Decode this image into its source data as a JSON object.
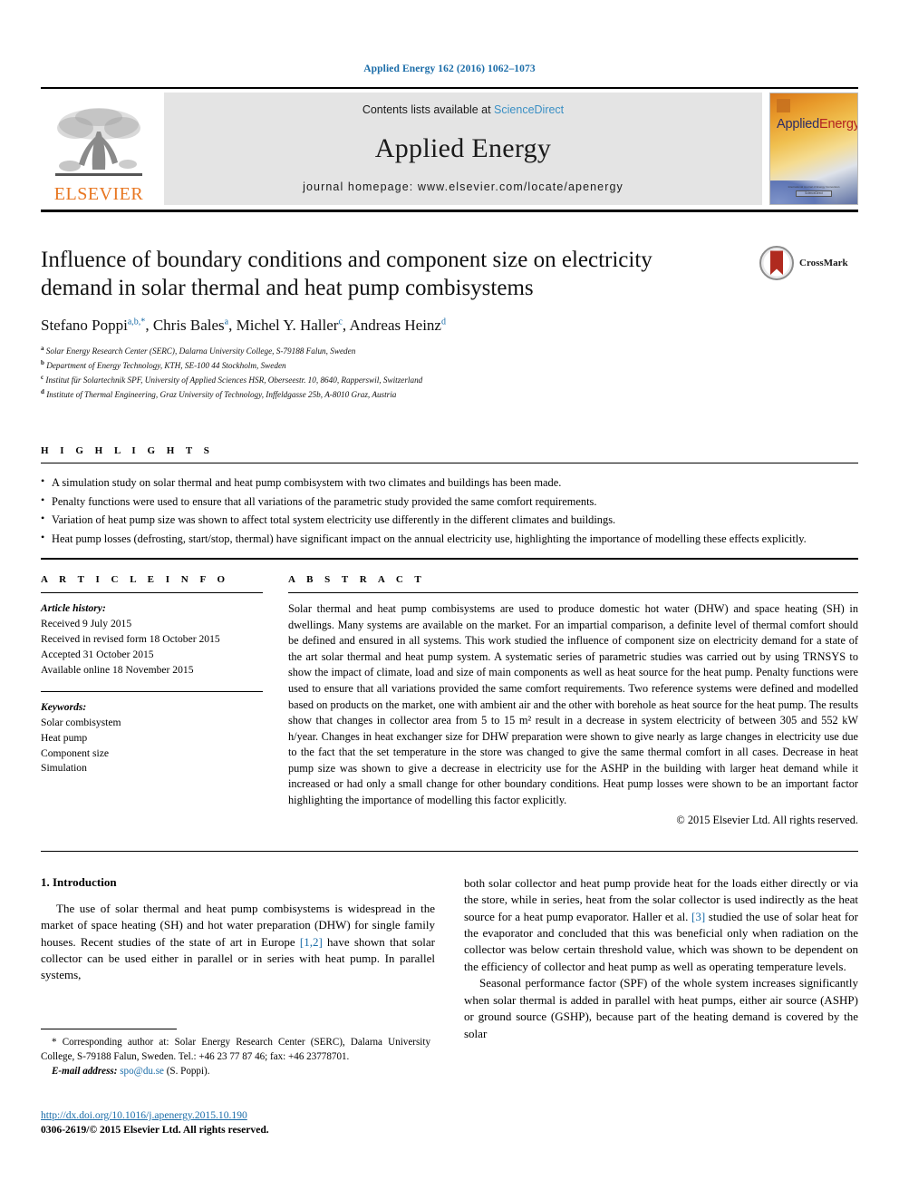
{
  "running_head": "Applied Energy 162 (2016) 1062–1073",
  "masthead": {
    "contents_prefix": "Contents lists available at ",
    "sciencedirect": "ScienceDirect",
    "journal_name": "Applied Energy",
    "homepage": "journal homepage: www.elsevier.com/locate/apenergy",
    "publisher_word": "ELSEVIER",
    "cover_title_a": "Applied",
    "cover_title_b": "Energy",
    "cover_footer": "International Journal of Energy Conversion",
    "cover_footer_box": "ScienceDirect",
    "colors": {
      "link_blue": "#1a6ca8",
      "sciencedirect_blue": "#3a8fc4",
      "elsevier_orange": "#E87722",
      "masthead_gray": "#e4e4e4"
    }
  },
  "crossmark": {
    "label": "CrossMark"
  },
  "title": "Influence of boundary conditions and component size on electricity demand in solar thermal and heat pump combisystems",
  "authors": [
    {
      "name": "Stefano Poppi",
      "sup": "a,b,*"
    },
    {
      "name": "Chris Bales",
      "sup": "a"
    },
    {
      "name": "Michel Y. Haller",
      "sup": "c"
    },
    {
      "name": "Andreas Heinz",
      "sup": "d"
    }
  ],
  "affiliations": [
    {
      "mark": "a",
      "text": "Solar Energy Research Center (SERC), Dalarna University College, S-79188 Falun, Sweden"
    },
    {
      "mark": "b",
      "text": "Department of Energy Technology, KTH, SE-100 44 Stockholm, Sweden"
    },
    {
      "mark": "c",
      "text": "Institut für Solartechnik SPF, University of Applied Sciences HSR, Oberseestr. 10, 8640, Rapperswil, Switzerland"
    },
    {
      "mark": "d",
      "text": "Institute of Thermal Engineering, Graz University of Technology, Inffeldgasse 25b, A-8010 Graz, Austria"
    }
  ],
  "highlights": {
    "heading": "H I G H L I G H T S",
    "items": [
      "A simulation study on solar thermal and heat pump combisystem with two climates and buildings has been made.",
      "Penalty functions were used to ensure that all variations of the parametric study provided the same comfort requirements.",
      "Variation of heat pump size was shown to affect total system electricity use differently in the different climates and buildings.",
      "Heat pump losses (defrosting, start/stop, thermal) have significant impact on the annual electricity use, highlighting the importance of modelling these effects explicitly."
    ]
  },
  "article_info": {
    "heading": "A R T I C L E    I N F O",
    "history_label": "Article history:",
    "history": [
      "Received 9 July 2015",
      "Received in revised form 18 October 2015",
      "Accepted 31 October 2015",
      "Available online 18 November 2015"
    ],
    "keywords_label": "Keywords:",
    "keywords": [
      "Solar combisystem",
      "Heat pump",
      "Component size",
      "Simulation"
    ]
  },
  "abstract": {
    "heading": "A B S T R A C T",
    "text": "Solar thermal and heat pump combisystems are used to produce domestic hot water (DHW) and space heating (SH) in dwellings. Many systems are available on the market. For an impartial comparison, a definite level of thermal comfort should be defined and ensured in all systems. This work studied the influence of component size on electricity demand for a state of the art solar thermal and heat pump system. A systematic series of parametric studies was carried out by using TRNSYS to show the impact of climate, load and size of main components as well as heat source for the heat pump. Penalty functions were used to ensure that all variations provided the same comfort requirements. Two reference systems were defined and modelled based on products on the market, one with ambient air and the other with borehole as heat source for the heat pump. The results show that changes in collector area from 5 to 15 m² result in a decrease in system electricity of between 305 and 552 kW h/year. Changes in heat exchanger size for DHW preparation were shown to give nearly as large changes in electricity use due to the fact that the set temperature in the store was changed to give the same thermal comfort in all cases. Decrease in heat pump size was shown to give a decrease in electricity use for the ASHP in the building with larger heat demand while it increased or had only a small change for other boundary conditions. Heat pump losses were shown to be an important factor highlighting the importance of modelling this factor explicitly.",
    "copyright": "© 2015 Elsevier Ltd. All rights reserved."
  },
  "introduction": {
    "section_number_title": "1. Introduction",
    "left_para_1_a": "The use of solar thermal and heat pump combisystems is widespread in the market of space heating (SH) and hot water preparation (DHW) for single family houses. Recent studies of the state of art in Europe ",
    "left_ref_1": "[1,2]",
    "left_para_1_b": " have shown that solar collector can be used either in parallel or in series with heat pump. In parallel systems,",
    "right_para_1_a": "both solar collector and heat pump provide heat for the loads either directly or via the store, while in series, heat from the solar collector is used indirectly as the heat source for a heat pump evaporator. Haller et al. ",
    "right_ref_1": "[3]",
    "right_para_1_b": " studied the use of solar heat for the evaporator and concluded that this was beneficial only when radiation on the collector was below certain threshold value, which was shown to be dependent on the efficiency of collector and heat pump as well as operating temperature levels.",
    "right_para_2": "Seasonal performance factor (SPF) of the whole system increases significantly when solar thermal is added in parallel with heat pumps, either air source (ASHP) or ground source (GSHP), because part of the heating demand is covered by the solar"
  },
  "footnote": {
    "corresponding": "* Corresponding author at: Solar Energy Research Center (SERC), Dalarna University College, S-79188 Falun, Sweden. Tel.: +46 23 77 87 46; fax: +46 23778701.",
    "email_label": "E-mail address:",
    "email": "spo@du.se",
    "email_owner": "(S. Poppi)."
  },
  "doi": {
    "url": "http://dx.doi.org/10.1016/j.apenergy.2015.10.190",
    "issn_line": "0306-2619/© 2015 Elsevier Ltd. All rights reserved."
  }
}
